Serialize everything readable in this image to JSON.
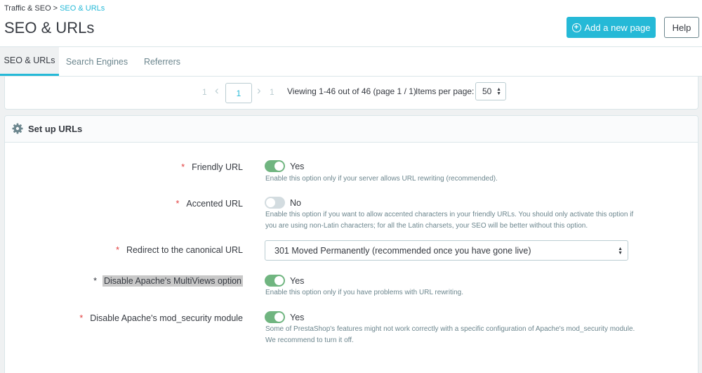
{
  "breadcrumb": {
    "parent": "Traffic & SEO",
    "separator": ">",
    "current": "SEO & URLs"
  },
  "header": {
    "title": "SEO & URLs",
    "add_button": "Add a new page",
    "help_button": "Help"
  },
  "tabs": [
    {
      "label": "SEO & URLs",
      "active": true
    },
    {
      "label": "Search Engines",
      "active": false
    },
    {
      "label": "Referrers",
      "active": false
    }
  ],
  "pagination": {
    "first": "1",
    "prev": "‹",
    "current": "1",
    "next": "›",
    "last": "1",
    "viewing": "Viewing 1-46 out of 46 (page 1 / 1)",
    "items_label": "Items per page:",
    "items_value": "50"
  },
  "panel": {
    "title": "Set up URLs",
    "fields": [
      {
        "label": "Friendly URL",
        "required": "*",
        "type": "switch",
        "state": "on",
        "value": "Yes",
        "help": [
          "Enable this option only if your server allows URL rewriting (recommended)."
        ]
      },
      {
        "label": "Accented URL",
        "required": "*",
        "type": "switch",
        "state": "off",
        "value": "No",
        "help": [
          "Enable this option if you want to allow accented characters in your friendly URLs. You should only activate this option if",
          "you are using non-Latin characters; for all the Latin charsets, your SEO will be better without this option."
        ]
      },
      {
        "label": "Redirect to the canonical URL",
        "required": "*",
        "type": "select",
        "value": "301 Moved Permanently (recommended once you have gone live)"
      },
      {
        "label": "Disable Apache's MultiViews option",
        "required": "*",
        "type": "switch",
        "state": "on",
        "value": "Yes",
        "highlighted": true,
        "help": [
          "Enable this option only if you have problems with URL rewriting."
        ]
      },
      {
        "label": "Disable Apache's mod_security module",
        "required": "*",
        "type": "switch",
        "state": "on",
        "value": "Yes",
        "help": [
          "Some of PrestaShop's features might not work correctly with a specific configuration of Apache's mod_security module.",
          "We recommend to turn it off."
        ]
      }
    ]
  },
  "colors": {
    "accent": "#25b9d7",
    "switch_on": "#70b580",
    "switch_off": "#d3dce0",
    "required": "#e23e3e"
  },
  "icons": {
    "gear": "gear-icon",
    "add": "plus-circle-icon"
  }
}
